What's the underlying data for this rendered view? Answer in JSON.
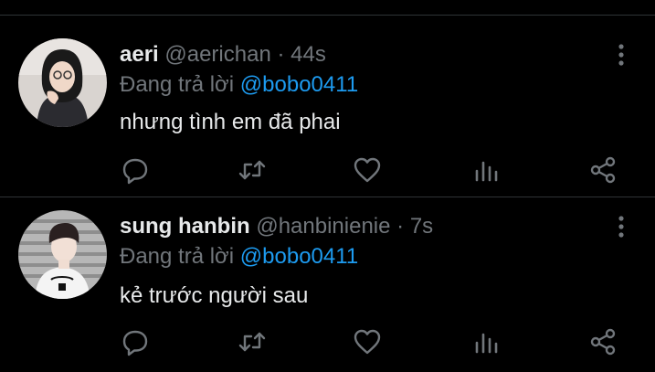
{
  "tweets": [
    {
      "name": "aeri",
      "handle": "@aerichan",
      "separator": "·",
      "time": "44s",
      "replying_prefix": "Đang trả lời",
      "replying_to": "@bobo0411",
      "text": "nhưng tình em đã phai",
      "avatar_icon": "avatar-aeri"
    },
    {
      "name": "sung hanbin",
      "handle": "@hanbinienie",
      "separator": "·",
      "time": "7s",
      "replying_prefix": "Đang trả lời",
      "replying_to": "@bobo0411",
      "text": "kẻ trước người sau",
      "avatar_icon": "avatar-hanbin"
    }
  ],
  "actions": [
    "reply-icon",
    "retweet-icon",
    "like-icon",
    "views-icon",
    "share-icon"
  ],
  "colors": {
    "background": "#000000",
    "text": "#e7e9ea",
    "muted": "#71767b",
    "mention": "#1d9bf0",
    "divider": "#2f3336"
  }
}
